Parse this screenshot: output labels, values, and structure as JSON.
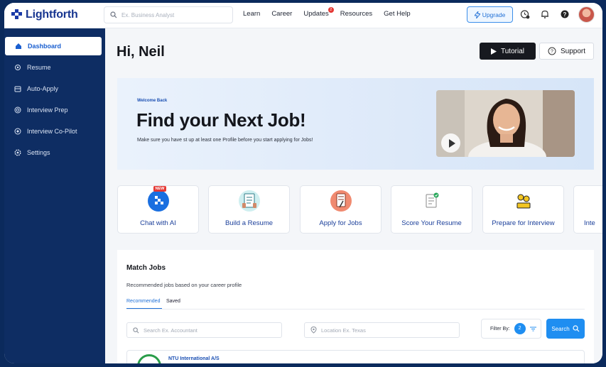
{
  "app": {
    "brand": "Lightforth"
  },
  "header": {
    "search_placeholder": "Ex. Business Analyst",
    "nav": [
      {
        "label": "Learn"
      },
      {
        "label": "Career"
      },
      {
        "label": "Updates",
        "badge": "2"
      },
      {
        "label": "Resources"
      },
      {
        "label": "Get Help"
      }
    ],
    "upgrade_label": "Upgrade"
  },
  "sidebar": {
    "items": [
      {
        "label": "Dashboard",
        "icon": "home-icon",
        "active": true
      },
      {
        "label": "Resume",
        "icon": "resume-icon"
      },
      {
        "label": "Auto-Apply",
        "icon": "auto-apply-icon"
      },
      {
        "label": "Interview Prep",
        "icon": "target-icon"
      },
      {
        "label": "Interview Co-Pilot",
        "icon": "copilot-icon"
      },
      {
        "label": "Settings",
        "icon": "gear-icon"
      }
    ]
  },
  "main": {
    "greeting": "Hi, Neil",
    "tutorial_label": "Tutorial",
    "support_label": "Support",
    "hero": {
      "eyebrow": "Welcome Back",
      "title": "Find your Next Job!",
      "subtitle": "Make sure you have st up at least one Profile before you start applying for Jobs!"
    },
    "cards": [
      {
        "label": "Chat with AI",
        "icon": "chat-ai-icon",
        "badge": "NEW"
      },
      {
        "label": "Build a Resume",
        "icon": "resume-build-icon"
      },
      {
        "label": "Apply for Jobs",
        "icon": "apply-jobs-icon"
      },
      {
        "label": "Score Your Resume",
        "icon": "score-resume-icon"
      },
      {
        "label": "Prepare for Interview",
        "icon": "prepare-interview-icon"
      },
      {
        "label": "Inte",
        "icon": "interview-icon"
      }
    ],
    "jobs": {
      "title": "Match Jobs",
      "subtitle": "Recommended jobs based on your career profile",
      "tabs": [
        {
          "label": "Recommended",
          "active": true
        },
        {
          "label": "Saved"
        }
      ],
      "search_placeholder": "Search Ex. Accountant",
      "location_placeholder": "Location Ex. Texas",
      "filter_label": "Filter By:",
      "filter_count": "2",
      "search_button": "Search",
      "listings": [
        {
          "company": "NTU International A/S"
        }
      ]
    }
  },
  "colors": {
    "sidebar_bg": "#0e2d63",
    "accent": "#1f8ef1",
    "brand": "#173590"
  }
}
